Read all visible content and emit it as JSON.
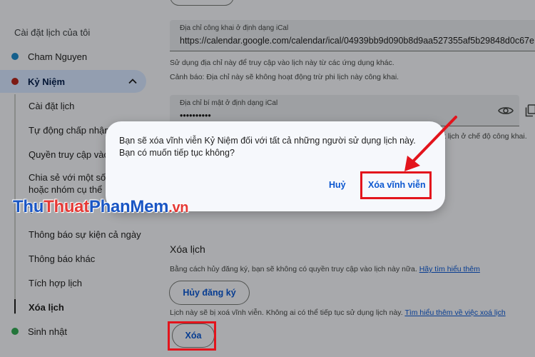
{
  "sidebar": {
    "heading": "Cài đặt lịch của tôi",
    "calendars": [
      {
        "label": "Cham Nguyen",
        "color": "#1e88c9"
      },
      {
        "label": "Kỷ Niệm",
        "color": "#b3261e"
      },
      {
        "label": "Sinh nhật",
        "color": "#33a853"
      }
    ],
    "subitems": [
      "Cài đặt lịch",
      "Tự động chấp nhận l",
      "Quyền truy cập vào",
      "Chia sẻ với một số n",
      "hoặc nhóm cụ thể",
      "T",
      "Thông báo sự kiện cả ngày",
      "Thông báo khác",
      "Tích hợp lịch",
      "Xóa lịch"
    ]
  },
  "main": {
    "public_field": {
      "label": "Địa chỉ công khai ở định dạng iCal",
      "value": "https://calendar.google.com/calendar/ical/04939bb9d090b8d9aa527355af5b29848d0c67e"
    },
    "public_help": "Sử dụng địa chỉ này để truy cập vào lịch này từ các ứng dụng khác.",
    "public_warning": "Cảnh báo: Địa chỉ này sẽ không hoạt động trừ phi lịch này công khai.",
    "secret_field": {
      "label": "Địa chỉ bí mật ở định dạng iCal",
      "value": "••••••••••"
    },
    "secret_partial_text": "t lịch ở chế độ công khai.",
    "remove_section": {
      "title": "Xóa lịch",
      "unsubscribe_text": "Bằng cách hủy đăng ký, bạn sẽ không có quyền truy cập vào lịch này nữa.",
      "unsubscribe_link": "Hãy tìm hiểu thêm",
      "unsubscribe_button": "Hủy đăng ký",
      "delete_text": "Lịch này sẽ bị xoá vĩnh viễn. Không ai có thể tiếp tục sử dụng lịch này.",
      "delete_link": "Tìm hiểu thêm về việc xoá lịch",
      "delete_button": "Xóa"
    }
  },
  "dialog": {
    "message": "Bạn sẽ xóa vĩnh viễn Kỷ Niệm đối với tất cả những người sử dụng lịch này. Bạn có muốn tiếp tục không?",
    "cancel_label": "Huỷ",
    "confirm_label": "Xóa vĩnh viễn"
  },
  "watermark": {
    "part1": "Thu",
    "part2": "Thuat",
    "part3": "PhanMem",
    "part4": ".vn"
  },
  "colors": {
    "accent": "#0b57d0",
    "highlight": "#e3141c",
    "active_bg": "#d3e3fd"
  }
}
